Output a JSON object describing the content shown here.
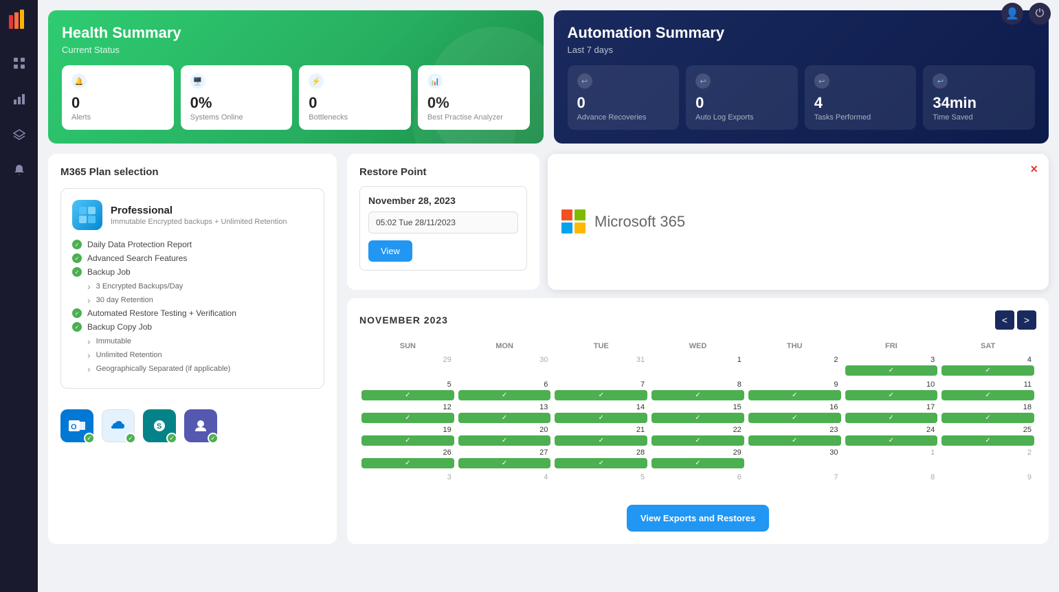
{
  "sidebar": {
    "icons": [
      "grid",
      "bar-chart",
      "layers",
      "bell"
    ]
  },
  "topbar": {
    "user_icon": "👤",
    "power_icon": "⏻"
  },
  "health_summary": {
    "title": "Health Summary",
    "subtitle": "Current Status",
    "metrics": [
      {
        "value": "0",
        "label": "Alerts"
      },
      {
        "value": "0%",
        "label": "Systems Online"
      },
      {
        "value": "0",
        "label": "Bottlenecks"
      },
      {
        "value": "0%",
        "label": "Best Practise Analyzer"
      }
    ]
  },
  "automation_summary": {
    "title": "Automation Summary",
    "subtitle": "Last 7 days",
    "metrics": [
      {
        "value": "0",
        "label": "Advance Recoveries"
      },
      {
        "value": "0",
        "label": "Auto Log Exports"
      },
      {
        "value": "4",
        "label": "Tasks Performed"
      },
      {
        "value": "34min",
        "label": "Time Saved"
      }
    ]
  },
  "plan_section": {
    "title": "M365 Plan selection",
    "plan_name": "Professional",
    "plan_desc": "Immutable Encrypted backups + Unlimited Retention",
    "features": [
      {
        "name": "Daily Data Protection Report",
        "sub": []
      },
      {
        "name": "Advanced Search Features",
        "sub": []
      },
      {
        "name": "Backup Job",
        "sub": [
          "3 Encrypted Backups/Day",
          "30 day Retention"
        ]
      },
      {
        "name": "Automated Restore Testing + Verification",
        "sub": []
      },
      {
        "name": "Backup Copy Job",
        "sub": [
          "Immutable",
          "Unlimited Retention",
          "Geographically Separated (if applicable)"
        ]
      }
    ],
    "apps": [
      {
        "name": "Outlook",
        "color": "#0078d4",
        "emoji": "📧"
      },
      {
        "name": "OneDrive",
        "color": "#0078d4",
        "emoji": "☁️"
      },
      {
        "name": "SharePoint",
        "color": "#038387",
        "emoji": "📋"
      },
      {
        "name": "Teams",
        "color": "#5558af",
        "emoji": "💬"
      }
    ]
  },
  "restore_point": {
    "title": "Restore Point",
    "date": "November 28, 2023",
    "time": "05:02 Tue 28/11/2023",
    "view_label": "View"
  },
  "ms365": {
    "name": "Microsoft 365",
    "colors": {
      "red": "#f25022",
      "green": "#7fba00",
      "blue": "#00a4ef",
      "yellow": "#ffb900"
    }
  },
  "calendar": {
    "month": "NOVEMBER 2023",
    "days_of_week": [
      "SUN",
      "MON",
      "TUE",
      "WED",
      "THU",
      "FRI",
      "SAT"
    ],
    "weeks": [
      [
        {
          "num": "29",
          "current": false,
          "check": false
        },
        {
          "num": "30",
          "current": false,
          "check": false
        },
        {
          "num": "31",
          "current": false,
          "check": false
        },
        {
          "num": "1",
          "current": true,
          "check": false
        },
        {
          "num": "2",
          "current": true,
          "check": false
        },
        {
          "num": "3",
          "current": true,
          "check": true
        },
        {
          "num": "4",
          "current": true,
          "check": true
        }
      ],
      [
        {
          "num": "5",
          "current": true,
          "check": true
        },
        {
          "num": "6",
          "current": true,
          "check": true
        },
        {
          "num": "7",
          "current": true,
          "check": true
        },
        {
          "num": "8",
          "current": true,
          "check": true
        },
        {
          "num": "9",
          "current": true,
          "check": true
        },
        {
          "num": "10",
          "current": true,
          "check": true
        },
        {
          "num": "11",
          "current": true,
          "check": true
        }
      ],
      [
        {
          "num": "12",
          "current": true,
          "check": true
        },
        {
          "num": "13",
          "current": true,
          "check": true
        },
        {
          "num": "14",
          "current": true,
          "check": true
        },
        {
          "num": "15",
          "current": true,
          "check": true
        },
        {
          "num": "16",
          "current": true,
          "check": true
        },
        {
          "num": "17",
          "current": true,
          "check": true
        },
        {
          "num": "18",
          "current": true,
          "check": true
        }
      ],
      [
        {
          "num": "19",
          "current": true,
          "check": true
        },
        {
          "num": "20",
          "current": true,
          "check": true
        },
        {
          "num": "21",
          "current": true,
          "check": true
        },
        {
          "num": "22",
          "current": true,
          "check": true
        },
        {
          "num": "23",
          "current": true,
          "check": true
        },
        {
          "num": "24",
          "current": true,
          "check": true
        },
        {
          "num": "25",
          "current": true,
          "check": true
        }
      ],
      [
        {
          "num": "26",
          "current": true,
          "check": true
        },
        {
          "num": "27",
          "current": true,
          "check": true
        },
        {
          "num": "28",
          "current": true,
          "check": true
        },
        {
          "num": "29",
          "current": true,
          "check": true
        },
        {
          "num": "30",
          "current": true,
          "check": false
        },
        {
          "num": "1",
          "current": false,
          "check": false
        },
        {
          "num": "2",
          "current": false,
          "check": false
        }
      ],
      [
        {
          "num": "3",
          "current": false,
          "check": false
        },
        {
          "num": "4",
          "current": false,
          "check": false
        },
        {
          "num": "5",
          "current": false,
          "check": false
        },
        {
          "num": "6",
          "current": false,
          "check": false
        },
        {
          "num": "7",
          "current": false,
          "check": false
        },
        {
          "num": "8",
          "current": false,
          "check": false
        },
        {
          "num": "9",
          "current": false,
          "check": false
        }
      ]
    ],
    "prev_label": "<",
    "next_label": ">"
  },
  "view_exports_label": "View Exports and Restores"
}
